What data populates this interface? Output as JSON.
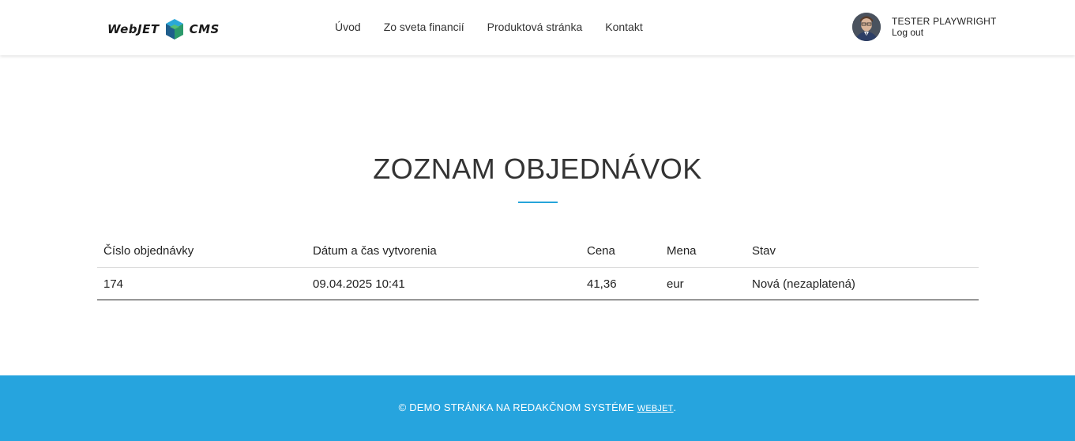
{
  "header": {
    "logo_left": "WebJET",
    "logo_right": "CMS",
    "nav": [
      "Úvod",
      "Zo sveta financií",
      "Produktová stránka",
      "Kontakt"
    ],
    "user_name": "TESTER PLAYWRIGHT",
    "logout_label": "Log out"
  },
  "main": {
    "title": "ZOZNAM OBJEDNÁVOK",
    "table": {
      "columns": [
        "Číslo objednávky",
        "Dátum a čas vytvorenia",
        "Cena",
        "Mena",
        "Stav"
      ],
      "rows": [
        [
          "174",
          "09.04.2025 10:41",
          "41,36",
          "eur",
          "Nová (nezaplatená)"
        ]
      ]
    }
  },
  "footer": {
    "text": "© DEMO STRÁNKA NA REDAKČNOM SYSTÉME",
    "link": "WEBJET",
    "suffix": "."
  },
  "colors": {
    "accent": "#26a4de",
    "text": "#333333"
  }
}
